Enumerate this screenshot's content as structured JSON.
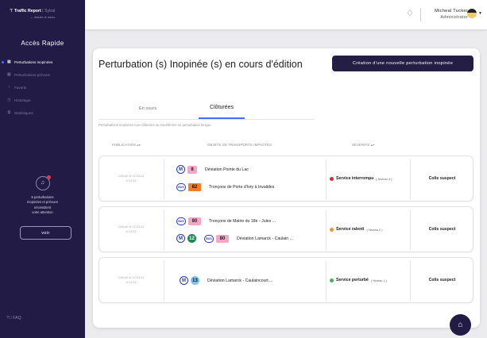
{
  "sidebar": {
    "logo_main": "Traffic Report",
    "logo_sep": "|",
    "logo_brand": "Sytral",
    "reduce_label": "← réduire le menu",
    "title": "Accès Rapide",
    "items": [
      {
        "icon": "grid-icon",
        "glyph": "▦",
        "label": "Perturbations inopinées",
        "active": true
      },
      {
        "icon": "grid-icon",
        "glyph": "▦",
        "label": "Perturbations prévues",
        "active": false
      },
      {
        "icon": "star-icon",
        "glyph": "☆",
        "label": "Favoris",
        "active": false
      },
      {
        "icon": "history-icon",
        "glyph": "◷",
        "label": "Historique",
        "active": false
      },
      {
        "icon": "stats-icon",
        "glyph": "⧉",
        "label": "Statistiques",
        "active": false
      }
    ],
    "alert_line1": "6 perturbations",
    "alert_line2": "inopinées et prévues",
    "alert_line3": "nécessitent",
    "alert_line4": "votre attention",
    "voir_label": "voir",
    "faq_label": "FAQ"
  },
  "topbar": {
    "user_name": "Micheal Tucker",
    "user_role": "Administrator"
  },
  "main": {
    "title": "Perturbation (s) Inopinée (s) en cours d'édition",
    "create_button": "Création d'une nouvelle perturbation inopinée",
    "tabs": [
      {
        "label": "En cours",
        "active": false
      },
      {
        "label": "Clôturées",
        "active": true
      }
    ],
    "subtext": "Perturbations inopinées non-clôturées ou transférées en perturbation longue.",
    "columns": {
      "publication": "PUBLICATION ▴▾",
      "objets": "OBJETS DE TRANSPORTS IMPACTÉS",
      "severite": "SÉVERITE ▴▾"
    },
    "rows": [
      {
        "date_line1": "Clôturé le 12.03.21",
        "date_line2": "à 14:32",
        "lines": [
          {
            "mode": "M",
            "num": "8",
            "num_style": "rose",
            "label": "Déviation Pointe du Lac"
          },
          {
            "mode": "BUS",
            "num": "82",
            "num_style": "orange",
            "label": "Tronçons de Porte d'Ivry à Invalides"
          }
        ],
        "severity": "Service interrompu",
        "severity_level": "( Niveau 3 )",
        "severity_color": "#e02a2a",
        "cause": "Colis suspect"
      },
      {
        "date_line1": "Clôturé le 12.03.21",
        "date_line2": "à 14:32",
        "lines": [
          {
            "mode": "BUS",
            "num": "80",
            "num_style": "rose-w",
            "label": "Tronçons de Mairie du 18e - Jules ..."
          },
          {
            "mode": "M",
            "num": "12",
            "num_style": "green",
            "mode2": "BUS",
            "num2": "80",
            "label": "Déviation Lamarck - Caulain ..."
          }
        ],
        "severity": "Service ralenti",
        "severity_level": "( Niveau 2 )",
        "severity_color": "#f0962a",
        "cause": "Colis suspect"
      },
      {
        "date_line1": "Clôturé le 12.03.21",
        "date_line2": "à 14:32",
        "lines": [
          {
            "mode": "M",
            "num": "13",
            "num_style": "blue",
            "label": "Déviation Lamarck - Caulaincourt ..."
          }
        ],
        "severity": "Service perturbé",
        "severity_level": "( Niveau 1 )",
        "severity_color": "#3dbb4f",
        "cause": "Colis suspect"
      }
    ]
  }
}
